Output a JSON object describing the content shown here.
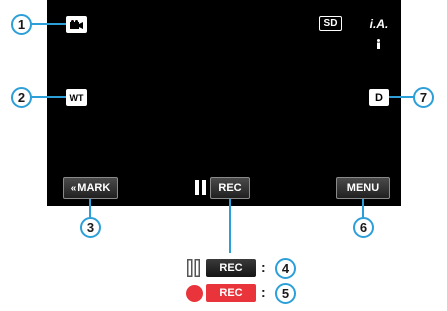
{
  "top_icons": {
    "mode_icon": "video-camera-icon",
    "sd_label": "SD",
    "ia_label": "i.A.",
    "ia_sub_icon": "auto-person-icon"
  },
  "left_icons": {
    "wt_label": "WT"
  },
  "right_icons": {
    "d_label": "D"
  },
  "bottom_bar": {
    "mark_label": "MARK",
    "pause_icon": "pause-icon",
    "rec_label": "REC",
    "menu_label": "MENU"
  },
  "legend": {
    "standby": {
      "rec_label": "REC",
      "icon": "pause-icon",
      "colon": ":"
    },
    "recording": {
      "rec_label": "REC",
      "icon": "record-dot-icon",
      "colon": ":",
      "color": "#e8343a"
    }
  },
  "callouts": [
    "1",
    "2",
    "3",
    "4",
    "5",
    "6",
    "7"
  ],
  "colors": {
    "accent": "#2d9fd8",
    "screen": "#000000",
    "record_red": "#e8343a"
  }
}
